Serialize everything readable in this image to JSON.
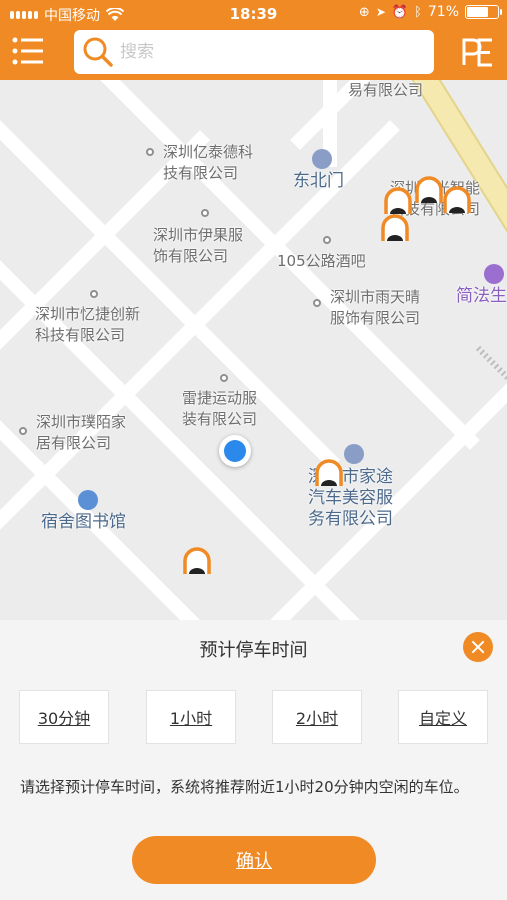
{
  "status_bar": {
    "carrier": "中国移动",
    "time": "18:39",
    "battery": "71%",
    "battery_level": 0.71
  },
  "header": {
    "menu_icon": "menu-icon",
    "search_placeholder": "搜索",
    "search_icon": "search-icon",
    "right_icon": "pe-icon"
  },
  "map": {
    "labels": {
      "top_cut": "易有限公司",
      "yitaide": "深圳亿泰德科技有限公司",
      "yitaide_l1": "深圳亿泰德科",
      "yitaide_l2": "技有限公司",
      "dongbeimen": "东北门",
      "oguang_l1": "深圳欧光智能",
      "oguang_l2": "科技有限公司",
      "yiguo_l1": "深圳市伊果服",
      "yiguo_l2": "饰有限公司",
      "jiuba": "105公路酒吧",
      "jianfa": "简法生",
      "yujie_l1": "深圳市忆捷创新",
      "yujie_l2": "科技有限公司",
      "yutianqing_l1": "深圳市雨天晴",
      "yutianqing_l2": "服饰有限公司",
      "leijie_l1": "雷捷运动服",
      "leijie_l2": "装有限公司",
      "pumo_l1": "深圳市璞陌家",
      "pumo_l2": "居有限公司",
      "jiatu_l1": "深圳市家途",
      "jiatu_l2": "汽车美容服",
      "jiatu_l3": "务有限公司",
      "library": "宿舍图书馆"
    },
    "parking_icon": "parking-marker-icon",
    "location_icon": "current-location-icon"
  },
  "panel": {
    "title": "预计停车时间",
    "close_icon": "close-icon",
    "options": [
      "30分钟",
      "1小时",
      "2小时",
      "自定义"
    ],
    "hint": "请选择预计停车时间，系统将推荐附近1小时20分钟内空闲的车位。",
    "confirm": "确认"
  },
  "colors": {
    "accent": "#f08a24",
    "location_blue": "#2a89ea",
    "map_bg": "#ececec"
  }
}
